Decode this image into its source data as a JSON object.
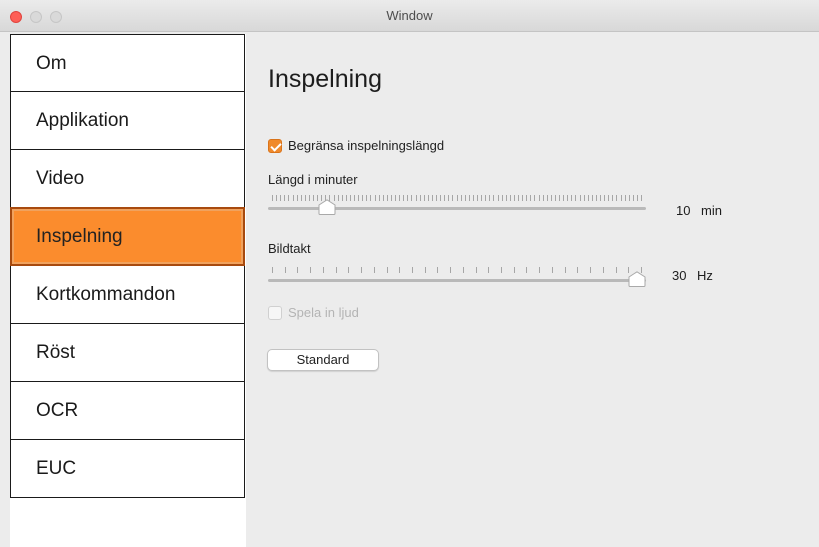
{
  "window": {
    "title": "Window"
  },
  "sidebar": {
    "items": [
      {
        "label": "Om"
      },
      {
        "label": "Applikation"
      },
      {
        "label": "Video"
      },
      {
        "label": "Inspelning",
        "selected": true
      },
      {
        "label": "Kortkommandon"
      },
      {
        "label": "Röst"
      },
      {
        "label": "OCR"
      },
      {
        "label": "EUC"
      }
    ]
  },
  "main": {
    "title": "Inspelning",
    "limit_checkbox": {
      "label": "Begränsa inspelningslängd",
      "checked": true
    },
    "length_slider": {
      "label": "Längd i minuter",
      "value": "10",
      "unit": "min",
      "fraction": 0.14
    },
    "framerate_slider": {
      "label": "Bildtakt",
      "value": "30",
      "unit": "Hz",
      "fraction": 1.0
    },
    "audio_checkbox": {
      "label": "Spela in ljud",
      "checked": false,
      "disabled": true
    },
    "standard_button": {
      "label": "Standard"
    }
  },
  "colors": {
    "accent": "#fb8c2d",
    "checkbox": "#f08a2c",
    "close": "#fe5f57"
  },
  "icons": {
    "close": "close-dot-icon",
    "minimize": "minimize-dot-icon",
    "maximize": "maximize-dot-icon",
    "slider_knob": "slider-knob-icon",
    "check": "checkmark-icon"
  }
}
